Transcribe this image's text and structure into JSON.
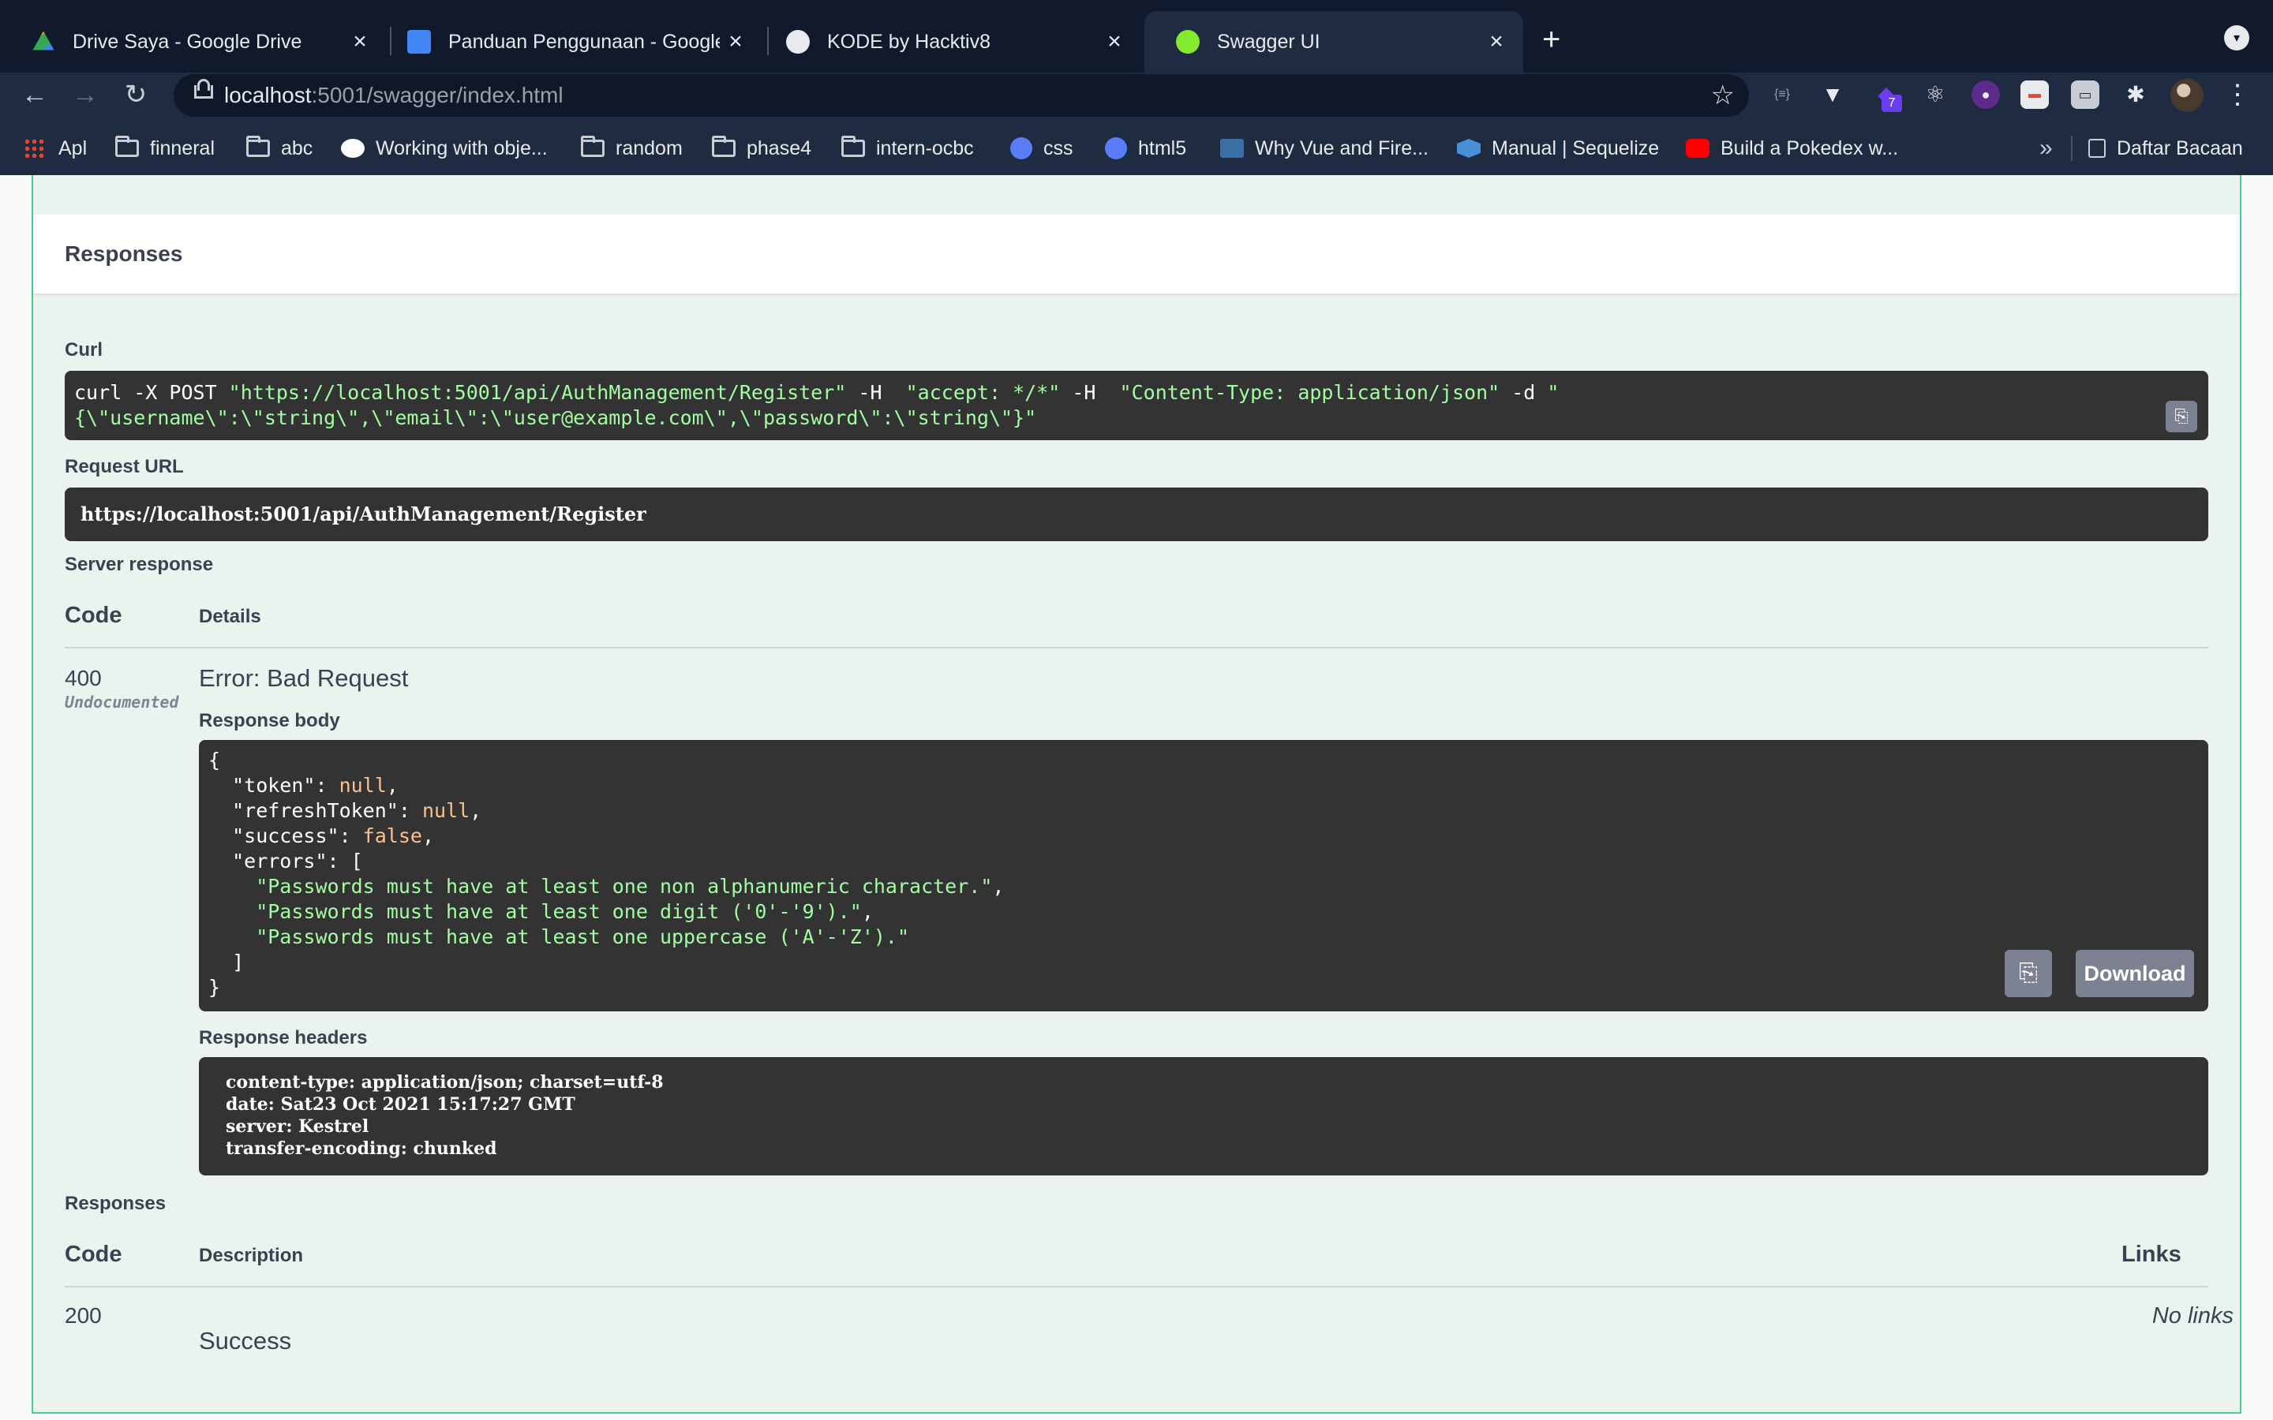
{
  "browser": {
    "tabs": [
      {
        "title": "Drive Saya - Google Drive",
        "icon": "google-drive-icon",
        "active": false
      },
      {
        "title": "Panduan Penggunaan - Google",
        "icon": "google-docs-icon",
        "active": false
      },
      {
        "title": "KODE by Hacktiv8",
        "icon": "hacktiv8-icon",
        "active": false
      },
      {
        "title": "Swagger UI",
        "icon": "swagger-icon",
        "active": true
      }
    ],
    "close_glyph": "×",
    "new_tab_glyph": "+",
    "url_host": "localhost",
    "url_rest": ":5001/swagger/index.html",
    "extension_badge": "7",
    "bookmarks": [
      {
        "label": "Apl",
        "kind": "apps"
      },
      {
        "label": "finneral",
        "kind": "folder"
      },
      {
        "label": "abc",
        "kind": "folder"
      },
      {
        "label": "Working with obje...",
        "kind": "link"
      },
      {
        "label": "random",
        "kind": "folder"
      },
      {
        "label": "phase4",
        "kind": "folder"
      },
      {
        "label": "intern-ocbc",
        "kind": "folder"
      },
      {
        "label": "css",
        "kind": "link"
      },
      {
        "label": "html5",
        "kind": "link"
      },
      {
        "label": "Why Vue and Fire...",
        "kind": "link"
      },
      {
        "label": "Manual | Sequelize",
        "kind": "link"
      },
      {
        "label": "Build a Pokedex w...",
        "kind": "link"
      }
    ],
    "more_glyph": "»",
    "reading_list": "Daftar Bacaan"
  },
  "swagger": {
    "responses_header": "Responses",
    "curl_label": "Curl",
    "curl_line1_cmd": "curl -X POST ",
    "curl_line1_url": "\"https://localhost:5001/api/AuthManagement/Register\"",
    "curl_line1_h1": " -H  ",
    "curl_line1_accept": "\"accept: */*\"",
    "curl_line1_h2": " -H  ",
    "curl_line1_ctype": "\"Content-Type: application/json\"",
    "curl_line1_d": " -d ",
    "curl_line1_q": "\"",
    "curl_line2": "{\\\"username\\\":\\\"string\\\",\\\"email\\\":\\\"user@example.com\\\",\\\"password\\\":\\\"string\\\"}\"",
    "request_url_label": "Request URL",
    "request_url": "https://localhost:5001/api/AuthManagement/Register",
    "server_response_label": "Server response",
    "col_code": "Code",
    "col_details": "Details",
    "status_code": "400",
    "undocumented": "Undocumented",
    "error_title": "Error: Bad Request",
    "response_body_label": "Response body",
    "body": {
      "open": "{",
      "token_key": "  \"token\": ",
      "token_val": "null",
      "refresh_key": "  \"refreshToken\": ",
      "refresh_val": "null",
      "success_key": "  \"success\": ",
      "success_val": "false",
      "errors_key": "  \"errors\": [",
      "err1": "    \"Passwords must have at least one non alphanumeric character.\"",
      "err2": "    \"Passwords must have at least one digit ('0'-'9').\"",
      "err3": "    \"Passwords must have at least one uppercase ('A'-'Z').\"",
      "errors_close": "  ]",
      "close": "}"
    },
    "download_label": "Download",
    "response_headers_label": "Response headers",
    "headers": [
      "content-type: application/json; charset=utf-8",
      "date: Sat23 Oct 2021 15:17:27 GMT",
      "server: Kestrel",
      "transfer-encoding: chunked"
    ],
    "responses_label": "Responses",
    "col_description": "Description",
    "col_links": "Links",
    "resp_code": "200",
    "resp_description": "Success",
    "no_links": "No links"
  },
  "colors": {
    "post_green": "#49cc90",
    "code_bg": "#333333",
    "string_green": "#a2fca2",
    "keyword_orange": "#fcc28c"
  }
}
